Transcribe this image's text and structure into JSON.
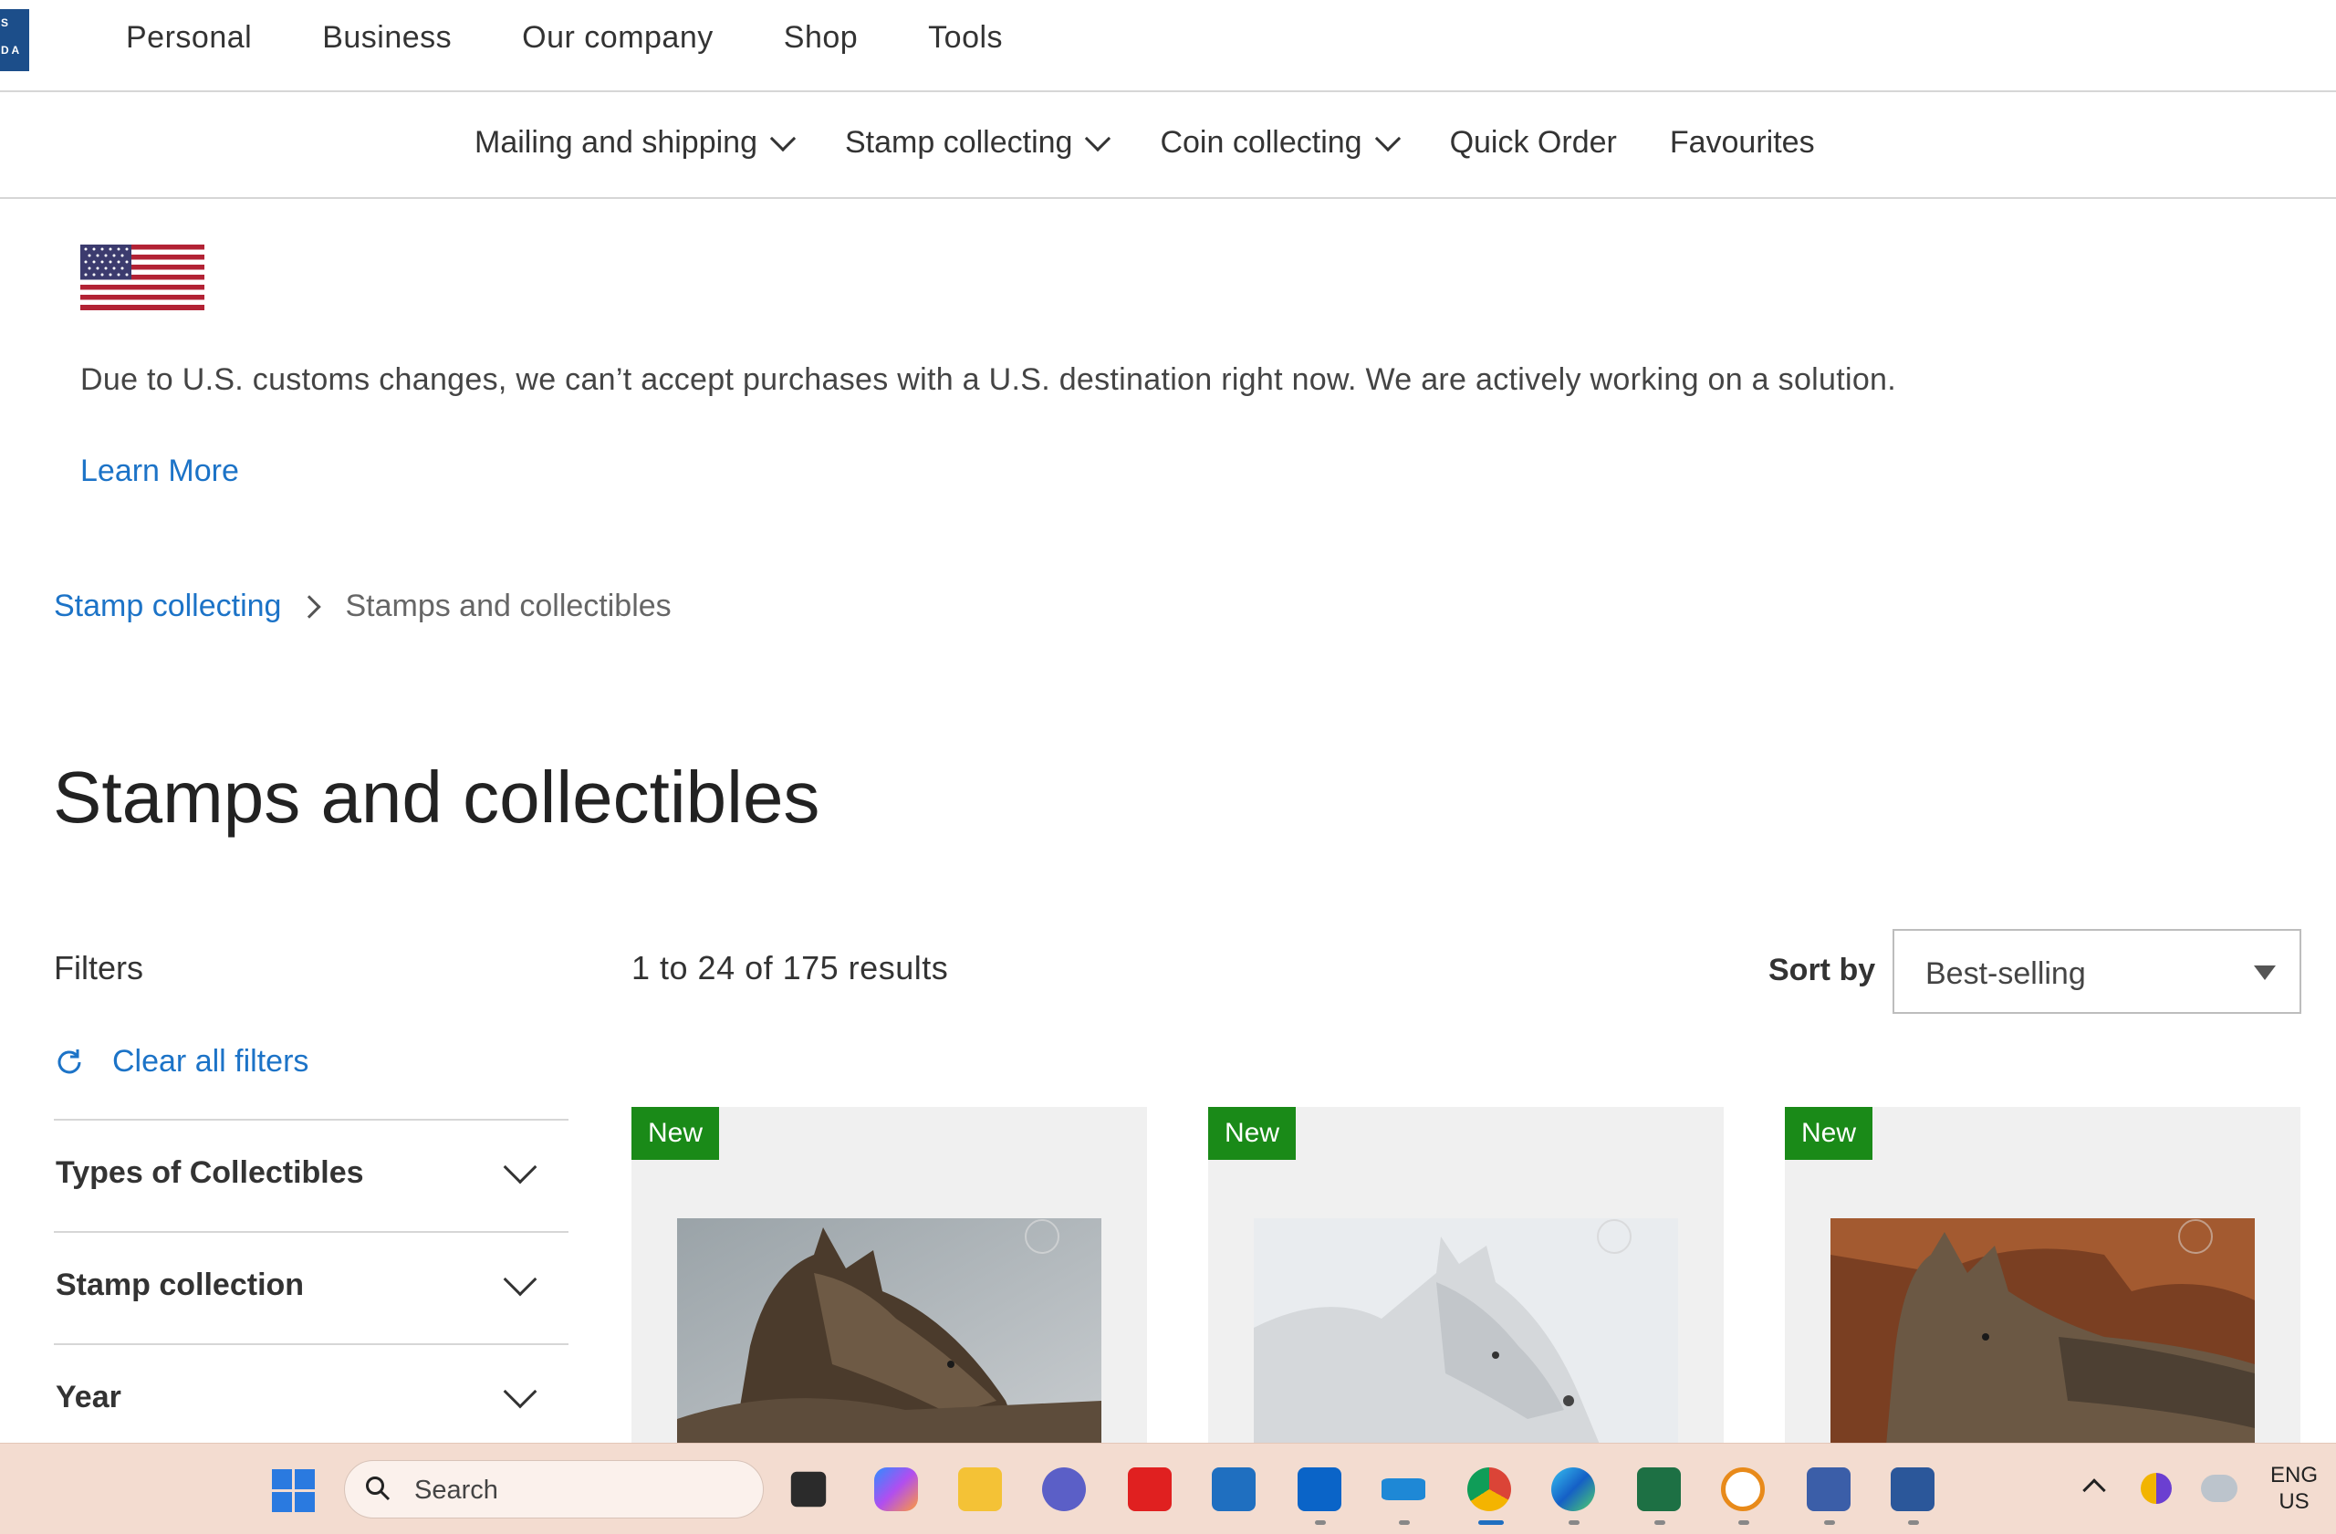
{
  "logo": {
    "line1": "S",
    "line2": "D A"
  },
  "top_nav": [
    "Personal",
    "Business",
    "Our company",
    "Shop",
    "Tools"
  ],
  "sub_nav": [
    {
      "label": "Mailing and shipping",
      "has_dropdown": true
    },
    {
      "label": "Stamp collecting",
      "has_dropdown": true
    },
    {
      "label": "Coin collecting",
      "has_dropdown": true
    },
    {
      "label": "Quick Order",
      "has_dropdown": false
    },
    {
      "label": "Favourites",
      "has_dropdown": false
    }
  ],
  "alert": {
    "icon": "us-flag-icon",
    "message": "Due to U.S. customs changes, we can’t accept purchases with a U.S. destination right now. We are actively working on a solution.",
    "link": "Learn More"
  },
  "breadcrumb": {
    "parent": "Stamp collecting",
    "current": "Stamps and collectibles"
  },
  "page_title": "Stamps and collectibles",
  "filters": {
    "title": "Filters",
    "clear_label": "Clear all filters",
    "facets": [
      "Types of Collectibles",
      "Stamp collection",
      "Year"
    ]
  },
  "results": {
    "count_text": "1 to 24 of 175 results",
    "sort_label": "Sort by",
    "sort_value": "Best-selling"
  },
  "products": [
    {
      "badge": "New",
      "image": "dark-wolf-lying-photo"
    },
    {
      "badge": "New",
      "image": "white-arctic-wolf-photo"
    },
    {
      "badge": "New",
      "image": "coyote-wolf-autumn-photo"
    }
  ],
  "taskbar": {
    "search_placeholder": "Search",
    "language_line1": "ENG",
    "language_line2": "US"
  },
  "colors": {
    "link": "#1c73c7",
    "badge": "#1a8a18",
    "brand_blue": "#1c4e8a",
    "taskbar": "#f3dcd0"
  }
}
